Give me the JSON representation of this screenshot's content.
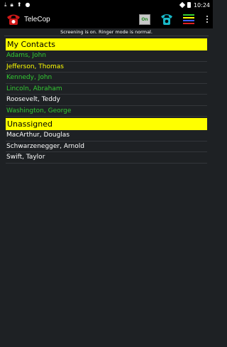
{
  "status_bar": {
    "time": "10:24"
  },
  "app_bar": {
    "title": "TeleCop",
    "toggle_label": "On"
  },
  "banner": "Screening is on. Ringer mode is normal.",
  "sections": [
    {
      "title": "My Contacts",
      "contacts": [
        {
          "name": "Adams, John",
          "color": "#33cc33"
        },
        {
          "name": "Jefferson, Thomas",
          "color": "#ffff00"
        },
        {
          "name": "Kennedy, John",
          "color": "#33cc33"
        },
        {
          "name": "Lincoln, Abraham",
          "color": "#33cc33"
        },
        {
          "name": "Roosevelt, Teddy",
          "color": "#ffffff"
        },
        {
          "name": "Washington, George",
          "color": "#33cc33"
        }
      ]
    },
    {
      "title": "Unassigned",
      "contacts": [
        {
          "name": "MacArthur, Douglas",
          "color": "#ffffff"
        },
        {
          "name": "Schwarzenegger, Arnold",
          "color": "#ffffff"
        },
        {
          "name": "Swift, Taylor",
          "color": "#ffffff"
        }
      ]
    }
  ],
  "colors": {
    "header_bg": "#ffff00",
    "background": "#1e2124",
    "toggle_text": "#2a8a2a"
  }
}
